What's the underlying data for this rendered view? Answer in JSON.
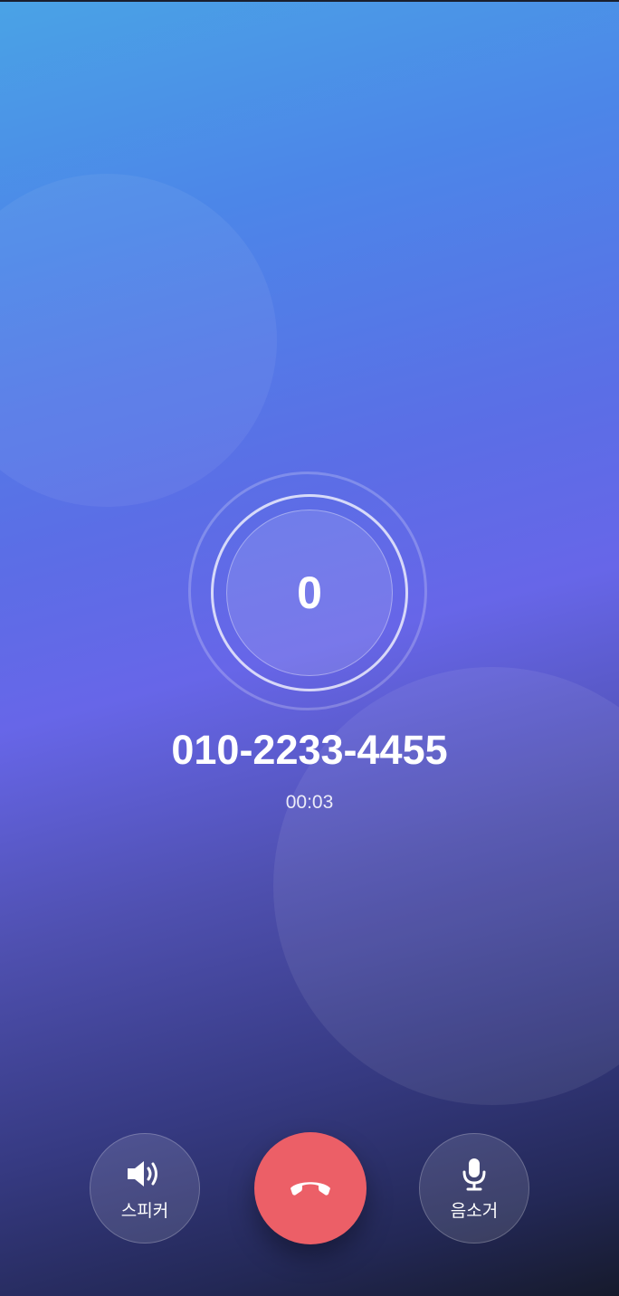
{
  "call": {
    "counter": "0",
    "phone_number": "010-2233-4455",
    "duration": "00:03"
  },
  "controls": {
    "speaker": {
      "label": "스피커",
      "icon": "speaker-icon"
    },
    "hangup": {
      "icon": "phone-hangup-icon",
      "color": "#ec5f67"
    },
    "mute": {
      "label": "음소거",
      "icon": "microphone-icon"
    }
  }
}
